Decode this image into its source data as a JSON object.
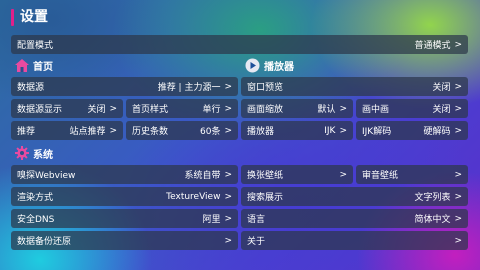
{
  "page": {
    "title": "设置"
  },
  "config": {
    "label": "配置模式",
    "value": "普通模式",
    "arrow": ">"
  },
  "home": {
    "title": "首页",
    "datasource": {
      "label": "数据源",
      "value": "推荐 | 主力源一",
      "arrow": ">"
    },
    "ds_display": {
      "label": "数据源显示",
      "value": "关闭",
      "arrow": ">"
    },
    "home_style": {
      "label": "首页样式",
      "value": "单行",
      "arrow": ">"
    },
    "recommend": {
      "label": "推荐",
      "value": "站点推荐",
      "arrow": ">"
    },
    "history": {
      "label": "历史条数",
      "value": "60条",
      "arrow": ">"
    }
  },
  "player": {
    "title": "播放器",
    "preview": {
      "label": "窗口预览",
      "value": "关闭",
      "arrow": ">"
    },
    "scale": {
      "label": "画面缩放",
      "value": "默认",
      "arrow": ">"
    },
    "pip": {
      "label": "画中画",
      "value": "关闭",
      "arrow": ">"
    },
    "player": {
      "label": "播放器",
      "value": "IJK",
      "arrow": ">"
    },
    "ijk_decode": {
      "label": "IJK解码",
      "value": "硬解码",
      "arrow": ">"
    }
  },
  "system": {
    "title": "系统",
    "webview": {
      "label": "嗅探Webview",
      "value": "系统自带",
      "arrow": ">"
    },
    "render": {
      "label": "渲染方式",
      "value": "TextureView",
      "arrow": ">"
    },
    "dns": {
      "label": "安全DNS",
      "value": "阿里",
      "arrow": ">"
    },
    "backup": {
      "label": "数据备份还原",
      "value": "",
      "arrow": ">"
    },
    "wallpaper": {
      "label": "换张壁纸",
      "arrow": ">"
    },
    "play_wallpaper": {
      "label": "审音壁纸",
      "arrow": ">"
    },
    "search_display": {
      "label": "搜索展示",
      "value": "文字列表",
      "arrow": ">"
    },
    "language": {
      "label": "语言",
      "value": "简体中文",
      "arrow": ">"
    },
    "about": {
      "label": "关于",
      "value": "",
      "arrow": ">"
    }
  },
  "colors": {
    "accent": "#e0208a",
    "icon_pink": "#e84aa0",
    "icon_blue": "#1d4f9a"
  }
}
